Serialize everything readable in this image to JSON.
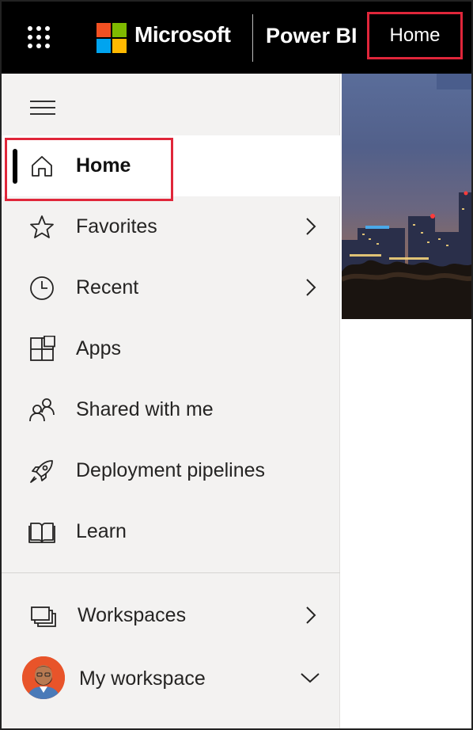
{
  "topbar": {
    "brand": "Microsoft",
    "product": "Power BI",
    "breadcrumb": "Home",
    "logo_colors": [
      "#f25022",
      "#7fba00",
      "#00a4ef",
      "#ffb900"
    ]
  },
  "nav": {
    "items": [
      {
        "label": "Home",
        "icon": "home-icon",
        "active": true,
        "chevron": false
      },
      {
        "label": "Favorites",
        "icon": "star-icon",
        "chevron": true
      },
      {
        "label": "Recent",
        "icon": "clock-icon",
        "chevron": true
      },
      {
        "label": "Apps",
        "icon": "apps-icon",
        "chevron": false
      },
      {
        "label": "Shared with me",
        "icon": "shared-people-icon",
        "chevron": false
      },
      {
        "label": "Deployment pipelines",
        "icon": "rocket-icon",
        "chevron": false
      },
      {
        "label": "Learn",
        "icon": "book-icon",
        "chevron": false
      }
    ],
    "workspaces": {
      "label": "Workspaces",
      "icon": "workspaces-icon"
    },
    "my_workspace": {
      "label": "My workspace",
      "icon": "avatar"
    }
  },
  "colors": {
    "highlight": "#e0263a",
    "nav_bg": "#f3f2f1",
    "topbar_bg": "#000000"
  }
}
